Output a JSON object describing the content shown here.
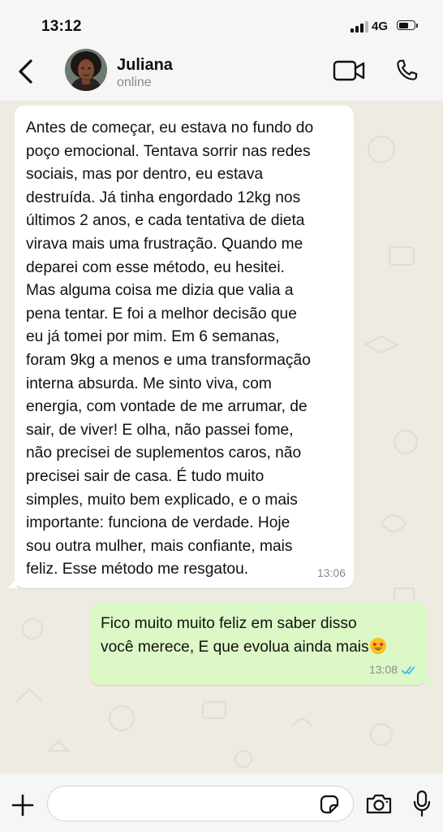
{
  "status_bar": {
    "time": "13:12",
    "network": "4G",
    "icons": [
      "signal-icon",
      "battery-icon"
    ]
  },
  "header": {
    "contact_name": "Juliana",
    "contact_status": "online",
    "icons": [
      "back-chevron-icon",
      "video-call-icon",
      "phone-call-icon"
    ]
  },
  "messages": [
    {
      "direction": "incoming",
      "text": "Antes de começar, eu estava no fundo do\npoço emocional. Tentava sorrir nas redes\nsociais, mas por dentro, eu estava\ndestruída. Já tinha engordado 12kg nos\núltimos 2 anos, e cada tentativa de dieta\nvirava mais uma frustração. Quando me\ndeparei com esse método, eu hesitei.\nMas alguma coisa me dizia que valia a\npena tentar. E foi a melhor decisão que\neu já tomei por mim. Em 6 semanas,\nforam 9kg a menos e uma transformação\ninterna absurda. Me sinto viva, com\nenergia, com vontade de me arrumar, de\nsair, de viver! E olha, não passei fome,\nnão precisei de suplementos caros, não\nprecisei sair de casa. É tudo muito\nsimples, muito bem explicado, e o mais\nimportante: funciona de verdade. Hoje\nsou outra mulher, mais confiante, mais\nfeliz. Esse método me resgatou.",
      "time": "13:06"
    },
    {
      "direction": "outgoing",
      "text": "Fico muito muito feliz em saber disso\nvocê merece, E que evolua ainda mais",
      "emoji": "star-struck-emoji",
      "time": "13:08",
      "read_receipt": "double-check-icon"
    }
  ],
  "input_bar": {
    "placeholder": "",
    "icons": [
      "plus-icon",
      "sticker-icon",
      "camera-icon",
      "microphone-icon"
    ]
  },
  "colors": {
    "incoming_bubble": "#ffffff",
    "outgoing_bubble": "#dcf8c6",
    "chat_background": "#efeae2",
    "read_receipt": "#34b7f1",
    "header_background": "#f6f6f6"
  }
}
